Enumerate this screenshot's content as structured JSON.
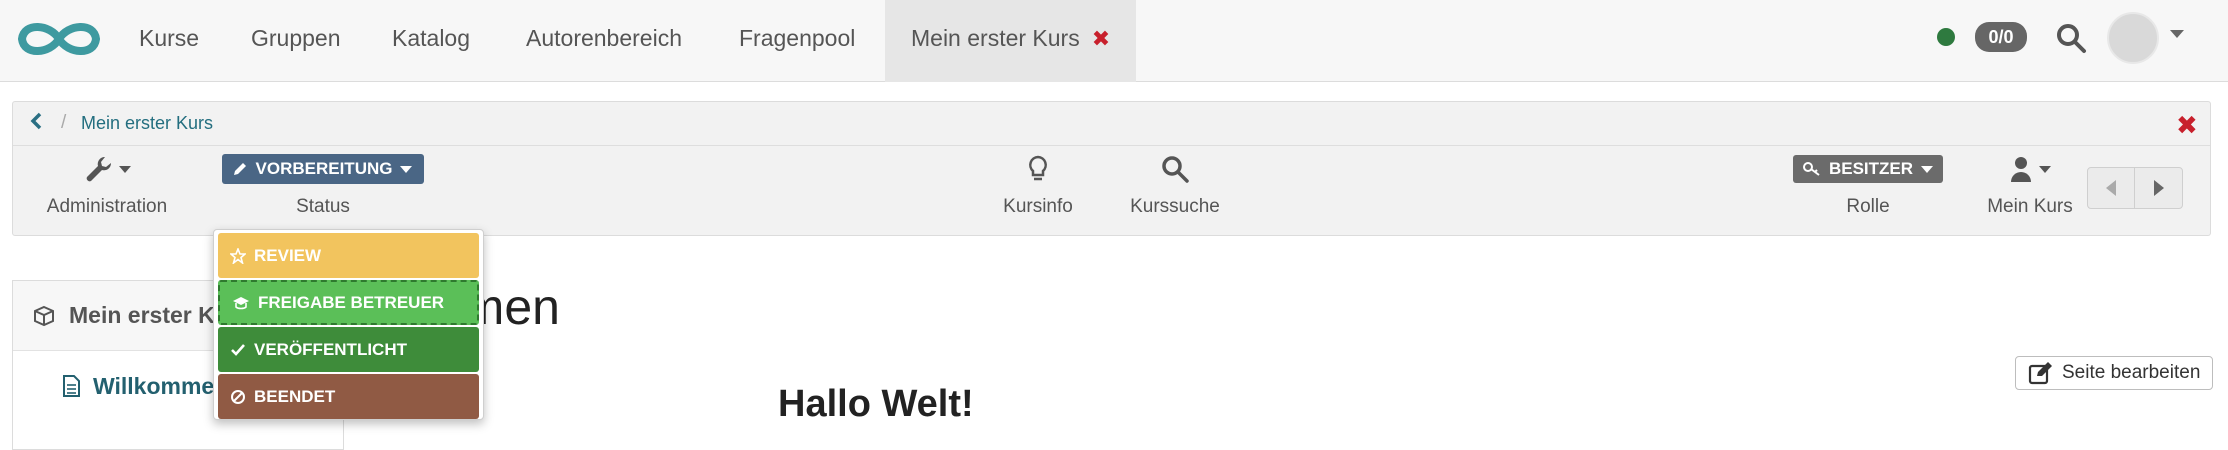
{
  "topnav": {
    "items": [
      {
        "label": "Kurse"
      },
      {
        "label": "Gruppen"
      },
      {
        "label": "Katalog"
      },
      {
        "label": "Autorenbereich"
      },
      {
        "label": "Fragenpool"
      }
    ],
    "active_tab": {
      "label": "Mein erster Kurs",
      "close": "✖"
    },
    "notifications_badge": "0/0",
    "status_color": "#2e7a3f"
  },
  "breadcrumb": {
    "back_icon": "chevron-left-icon",
    "separator": "/",
    "current": "Mein erster Kurs",
    "close": "✖"
  },
  "toolbar": {
    "administration_label": "Administration",
    "status_button": "VORBEREITUNG",
    "status_label": "Status",
    "kursinfo_label": "Kursinfo",
    "kurssuche_label": "Kurssuche",
    "role_button": "BESITZER",
    "role_label": "Rolle",
    "mein_kurs_label": "Mein Kurs"
  },
  "status_dropdown": {
    "options": [
      {
        "label": "REVIEW",
        "color": "#f2c45e",
        "icon": "star-icon"
      },
      {
        "label": "FREIGABE BETREUER",
        "color": "#5bbf58",
        "icon": "graduation-cap-icon"
      },
      {
        "label": "VERÖFFENTLICHT",
        "color": "#3e8c3a",
        "icon": "check-icon"
      },
      {
        "label": "BEENDET",
        "color": "#905a44",
        "icon": "ban-icon"
      }
    ]
  },
  "sidebar": {
    "root_label": "Mein erster Ku",
    "node_label": "Willkomme"
  },
  "main": {
    "title": "llkommen",
    "hello": "Hallo Welt!",
    "edit_button": "Seite bearbeiten"
  }
}
